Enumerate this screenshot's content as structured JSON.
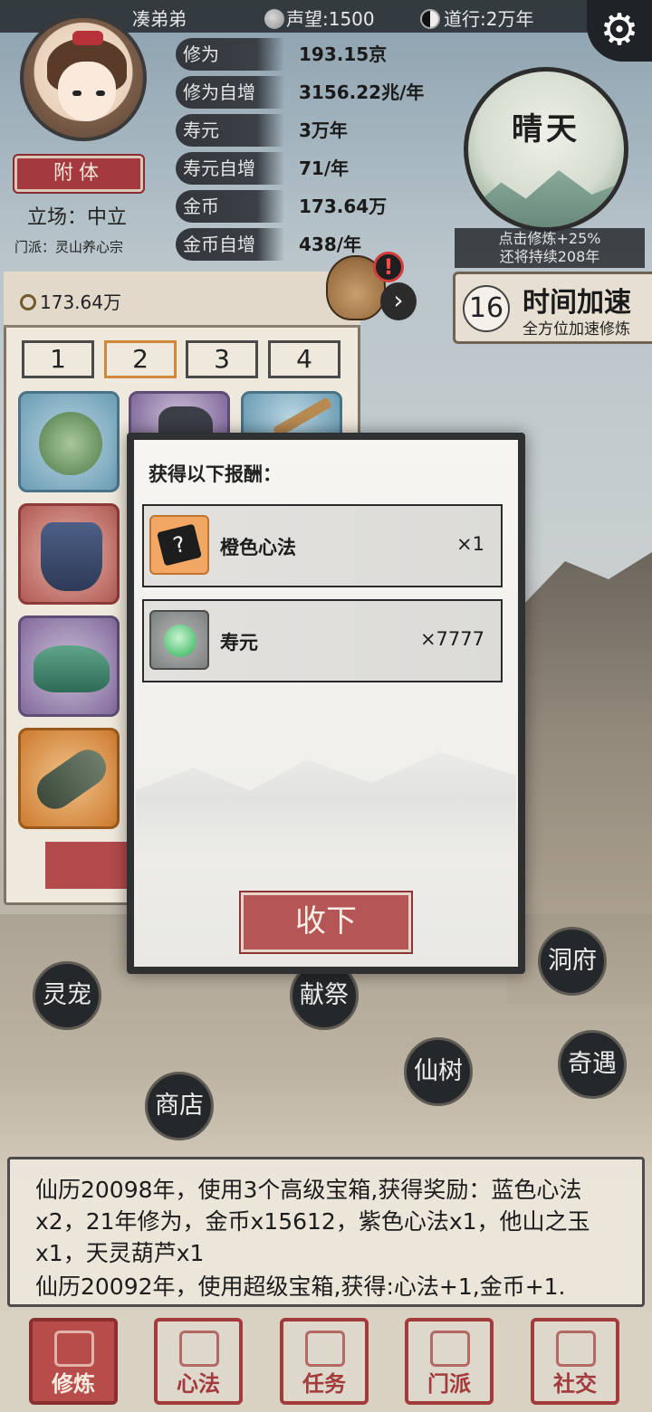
{
  "top_bar": {
    "player_name": "凑弟弟",
    "reputation_label": "声望:1500",
    "daoxing_label": "道行:2万年"
  },
  "profile": {
    "attach_button": "附体",
    "stance": "立场：中立",
    "sect": "门派：灵山养心宗"
  },
  "stats": [
    {
      "label": "修为",
      "value": "193.15京"
    },
    {
      "label": "修为自增",
      "value": "3156.22兆/年"
    },
    {
      "label": "寿元",
      "value": "3万年"
    },
    {
      "label": "寿元自增",
      "value": "71/年"
    },
    {
      "label": "金币",
      "value": "173.64万"
    },
    {
      "label": "金币自增",
      "value": "438/年"
    }
  ],
  "weather": {
    "title": "晴天",
    "note_line1": "点击修炼+25%",
    "note_line2": "还将持续208年"
  },
  "speedup": {
    "count": "16",
    "title": "时间加速",
    "subtitle": "全方位加速修炼"
  },
  "inventory": {
    "gold": "173.64万",
    "tabs": [
      "1",
      "2",
      "3",
      "4"
    ],
    "active_tab": "2",
    "alert": "!"
  },
  "scene_buttons": {
    "pet": "灵宠",
    "sacrifice": "献祭",
    "cave": "洞府",
    "shop": "商店",
    "tree": "仙树",
    "encounter": "奇遇"
  },
  "log": [
    "仙历20098年，使用3个高级宝箱,获得奖励：蓝色心法x2，21年修为，金币x15612，紫色心法x1，他山之玉x1，天灵葫芦x1",
    "仙历20092年，使用超级宝箱,获得:心法+1,金币+1."
  ],
  "bottom_nav": [
    {
      "label": "修炼",
      "active": true
    },
    {
      "label": "心法",
      "active": false
    },
    {
      "label": "任务",
      "active": false
    },
    {
      "label": "门派",
      "active": false
    },
    {
      "label": "社交",
      "active": false
    }
  ],
  "modal": {
    "title": "获得以下报酬：",
    "rewards": [
      {
        "name": "橙色心法",
        "qty": "×1",
        "icon": "mystery-book-icon"
      },
      {
        "name": "寿元",
        "qty": "×7777",
        "icon": "jade-orb-icon"
      }
    ],
    "accept_button": "收下"
  },
  "colors": {
    "accent_red": "#b65555",
    "panel_dark": "#2f3032",
    "tab_active_border": "#d0883a"
  }
}
